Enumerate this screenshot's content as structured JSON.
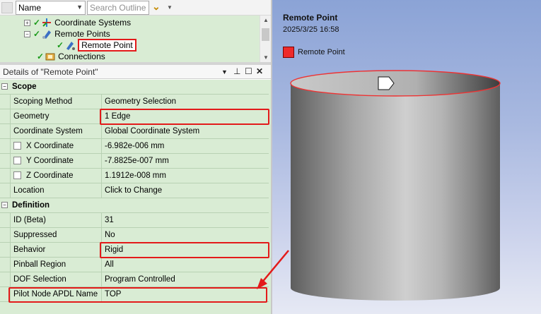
{
  "toolbar": {
    "name_combo": "Name",
    "search_placeholder": "Search Outline"
  },
  "tree": {
    "items": [
      {
        "label": "Coordinate Systems"
      },
      {
        "label": "Remote Points"
      },
      {
        "label": "Remote Point"
      },
      {
        "label": "Connections"
      }
    ]
  },
  "details": {
    "title": "Details of \"Remote Point\"",
    "sections": {
      "scope": "Scope",
      "definition": "Definition"
    },
    "rows": [
      {
        "label": "Scoping Method",
        "value": "Geometry Selection"
      },
      {
        "label": "Geometry",
        "value": "1 Edge"
      },
      {
        "label": "Coordinate System",
        "value": "Global Coordinate System"
      },
      {
        "label": "X Coordinate",
        "value": "-6.982e-006 mm"
      },
      {
        "label": "Y Coordinate",
        "value": "-7.8825e-007 mm"
      },
      {
        "label": "Z Coordinate",
        "value": "1.1912e-008 mm"
      },
      {
        "label": "Location",
        "value": "Click to Change"
      },
      {
        "label": "ID (Beta)",
        "value": "31"
      },
      {
        "label": "Suppressed",
        "value": "No"
      },
      {
        "label": "Behavior",
        "value": "Rigid"
      },
      {
        "label": "Pinball Region",
        "value": "All"
      },
      {
        "label": "DOF Selection",
        "value": "Program Controlled"
      },
      {
        "label": "Pilot Node APDL Name",
        "value": "TOP"
      }
    ]
  },
  "viewport": {
    "title": "Remote Point",
    "date": "2025/3/25 16:58",
    "legend_label": "Remote Point",
    "legend_color": "#ee2a2a"
  },
  "colors": {
    "highlight": "#e31a1a",
    "grid_bg": "#d9ecd4"
  }
}
